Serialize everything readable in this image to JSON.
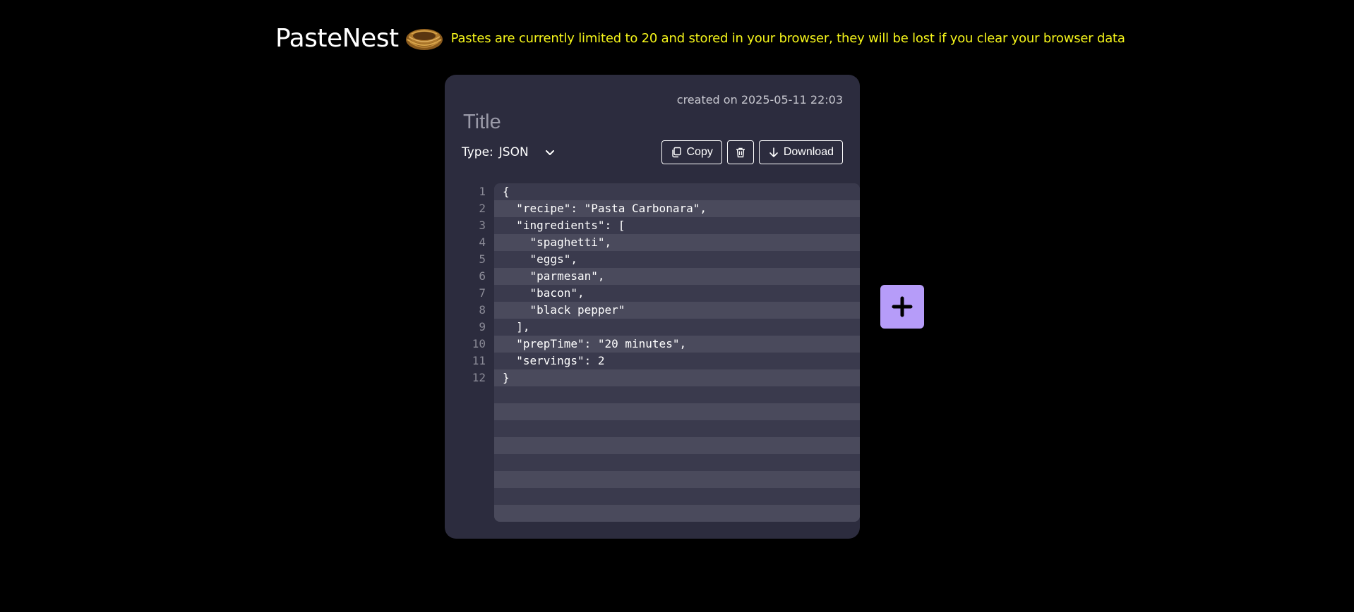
{
  "header": {
    "app_title": "PasteNest",
    "notice": "Pastes are currently limited to 20 and stored in your browser, they will be lost if you clear your browser data",
    "logo_icon": "nest-icon"
  },
  "paste": {
    "created": "created on 2025-05-11 22:03",
    "title_placeholder": "Title",
    "type_label": "Type:",
    "type_value": "JSON",
    "copy_label": "Copy",
    "download_label": "Download",
    "delete_icon": "trash-icon",
    "line_numbers": [
      "1",
      "2",
      "3",
      "4",
      "5",
      "6",
      "7",
      "8",
      "9",
      "10",
      "11",
      "12"
    ],
    "code_lines": [
      "{",
      "  \"recipe\": \"Pasta Carbonara\",",
      "  \"ingredients\": [",
      "    \"spaghetti\",",
      "    \"eggs\",",
      "    \"parmesan\",",
      "    \"bacon\",",
      "    \"black pepper\"",
      "  ],",
      "  \"prepTime\": \"20 minutes\",",
      "  \"servings\": 2",
      "}"
    ]
  },
  "add_button": {
    "icon": "plus-icon",
    "color": "#b69cf9"
  },
  "colors": {
    "background": "#000000",
    "card": "#2c2c3e",
    "notice": "#f5f51a"
  }
}
